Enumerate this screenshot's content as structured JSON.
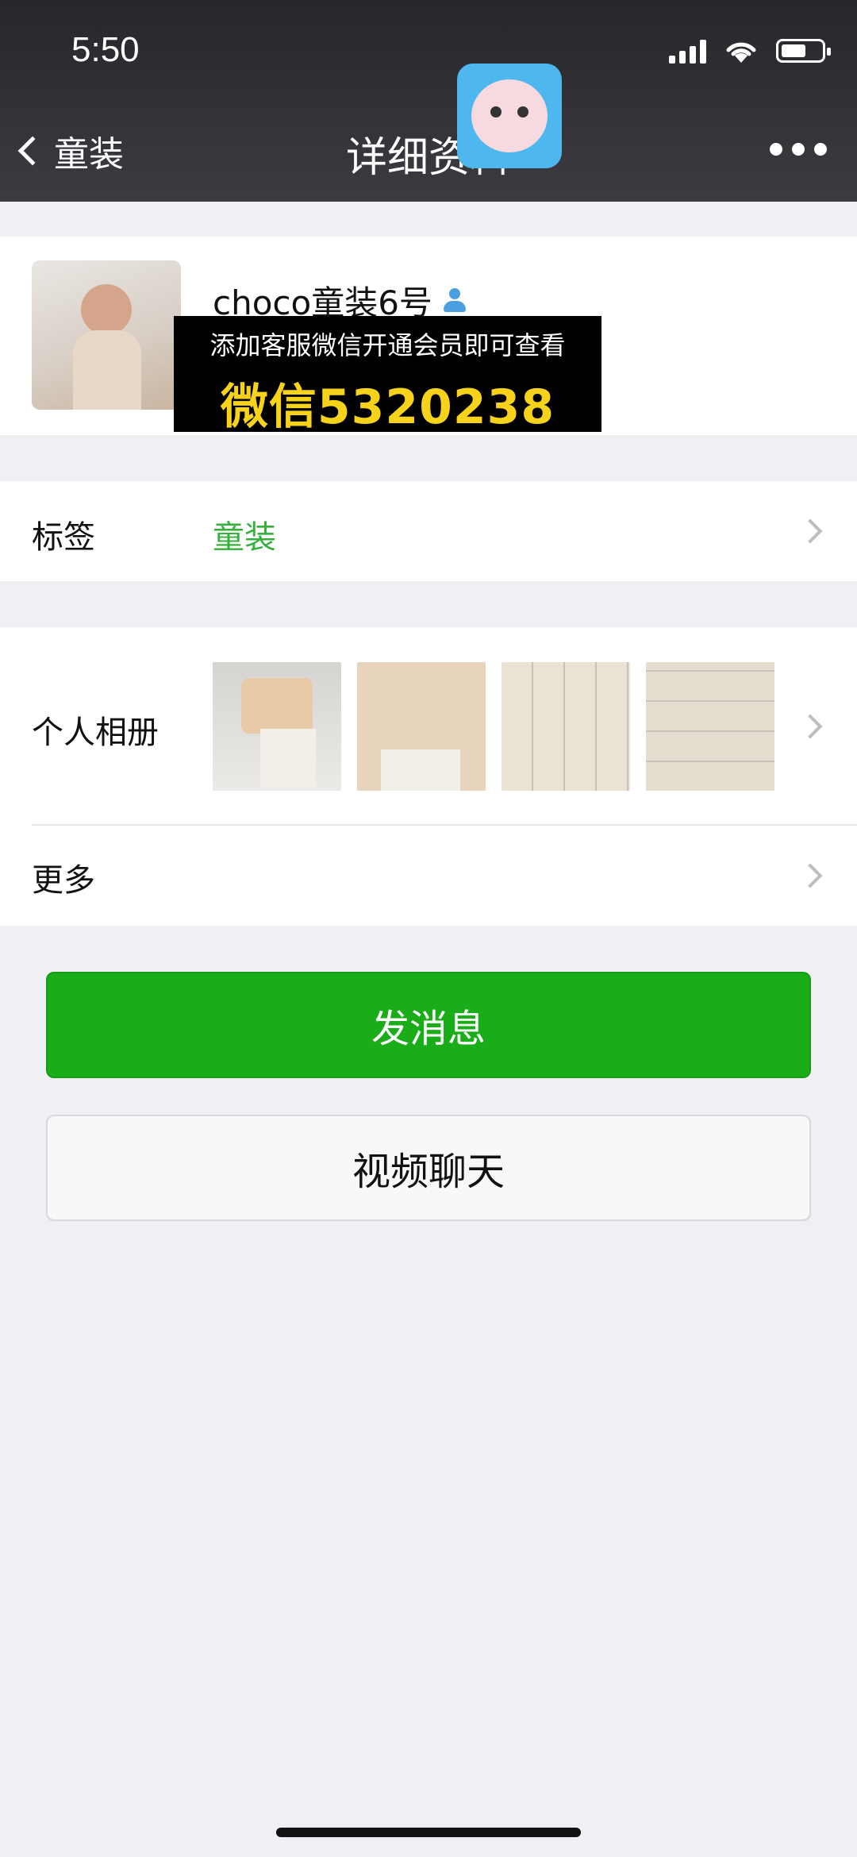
{
  "status_bar": {
    "time": "5:50"
  },
  "nav": {
    "back_label": "童装",
    "title": "详细资料"
  },
  "profile": {
    "name": "choco童装6号"
  },
  "promo_overlay": {
    "line1": "添加客服微信开通会员即可查看",
    "line2": "微信5320238"
  },
  "rows": {
    "tag": {
      "label": "标签",
      "value": "童装"
    },
    "album": {
      "label": "个人相册"
    },
    "more": {
      "label": "更多"
    }
  },
  "buttons": {
    "send_message": "发消息",
    "video_chat": "视频聊天"
  },
  "colors": {
    "header_bg": "#2c2c31",
    "primary_green": "#1aad19",
    "tag_green": "#34b03b",
    "promo_yellow": "#f6d21b",
    "page_bg": "#efeff4"
  },
  "icons": [
    "back-chevron-icon",
    "more-dots-icon",
    "person-icon",
    "row-chevron-icon",
    "signal-icon",
    "wifi-icon",
    "battery-icon"
  ]
}
